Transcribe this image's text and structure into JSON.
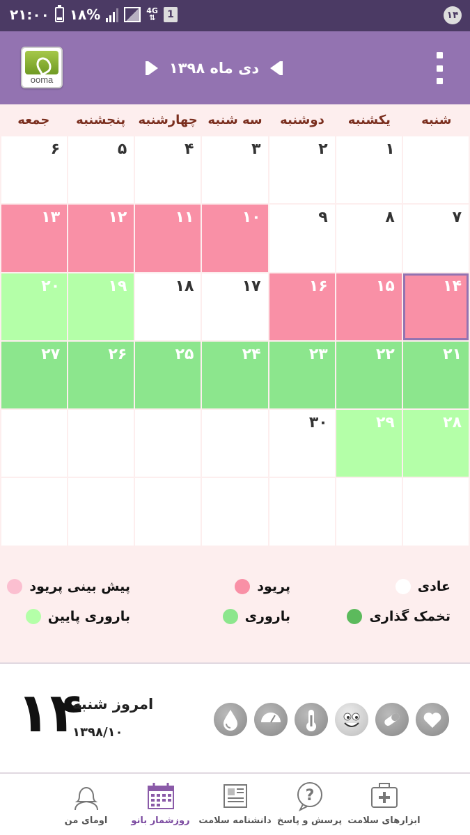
{
  "status_bar": {
    "time": "۲۱:۰۰",
    "battery": "۱۸%",
    "network": "4G",
    "sim_slot": "1",
    "notification": "۱۴"
  },
  "app_bar": {
    "logo_text": "ooma",
    "month_title": "دی ماه ۱۳۹۸"
  },
  "weekdays": [
    "شنبه",
    "یکشنبه",
    "دوشنبه",
    "سه شنبه",
    "چهارشنبه",
    "پنجشنبه",
    "جمعه"
  ],
  "calendar": {
    "rows": [
      [
        {
          "d": "",
          "t": "n"
        },
        {
          "d": "۱",
          "t": "n"
        },
        {
          "d": "۲",
          "t": "n"
        },
        {
          "d": "۳",
          "t": "n"
        },
        {
          "d": "۴",
          "t": "n"
        },
        {
          "d": "۵",
          "t": "n"
        },
        {
          "d": "۶",
          "t": "n"
        }
      ],
      [
        {
          "d": "۷",
          "t": "n"
        },
        {
          "d": "۸",
          "t": "n"
        },
        {
          "d": "۹",
          "t": "n"
        },
        {
          "d": "۱۰",
          "t": "p"
        },
        {
          "d": "۱۱",
          "t": "p"
        },
        {
          "d": "۱۲",
          "t": "p"
        },
        {
          "d": "۱۳",
          "t": "p"
        }
      ],
      [
        {
          "d": "۱۴",
          "t": "p",
          "today": true
        },
        {
          "d": "۱۵",
          "t": "p"
        },
        {
          "d": "۱۶",
          "t": "p"
        },
        {
          "d": "۱۷",
          "t": "n"
        },
        {
          "d": "۱۸",
          "t": "n"
        },
        {
          "d": "۱۹",
          "t": "l"
        },
        {
          "d": "۲۰",
          "t": "l"
        }
      ],
      [
        {
          "d": "۲۱",
          "t": "f"
        },
        {
          "d": "۲۲",
          "t": "f"
        },
        {
          "d": "۲۳",
          "t": "f"
        },
        {
          "d": "۲۴",
          "t": "f"
        },
        {
          "d": "۲۵",
          "t": "f"
        },
        {
          "d": "۲۶",
          "t": "f"
        },
        {
          "d": "۲۷",
          "t": "f"
        }
      ],
      [
        {
          "d": "۲۸",
          "t": "l"
        },
        {
          "d": "۲۹",
          "t": "l"
        },
        {
          "d": "۳۰",
          "t": "n"
        },
        {
          "d": "",
          "t": "n"
        },
        {
          "d": "",
          "t": "n"
        },
        {
          "d": "",
          "t": "n"
        },
        {
          "d": "",
          "t": "n"
        }
      ],
      [
        {
          "d": "",
          "t": "n"
        },
        {
          "d": "",
          "t": "n"
        },
        {
          "d": "",
          "t": "n"
        },
        {
          "d": "",
          "t": "n"
        },
        {
          "d": "",
          "t": "n"
        },
        {
          "d": "",
          "t": "n"
        },
        {
          "d": "",
          "t": "n"
        }
      ]
    ]
  },
  "legend": {
    "normal": {
      "label": "عادی",
      "color": "#ffffff"
    },
    "period": {
      "label": "پریود",
      "color": "#f990a6"
    },
    "period_prediction": {
      "label": "پیش بینی پریود",
      "color": "#fbbfd0"
    },
    "ovulation": {
      "label": "تخمک گذاری",
      "color": "#5cba5c"
    },
    "fertile": {
      "label": "باروری",
      "color": "#8ce68d"
    },
    "low_fertility": {
      "label": "باروری پایین",
      "color": "#b4ffa8"
    }
  },
  "today": {
    "day": "۱۴",
    "label": "امروز شنبه",
    "date": "۱۳۹۸/۱۰"
  },
  "tools": [
    "heart-icon",
    "pill-icon",
    "smiley-icon",
    "thermometer-icon",
    "weight-scale-icon",
    "drop-icon"
  ],
  "bottom_nav": [
    {
      "label": "ابزارهای سلامت",
      "icon": "first-aid-kit-icon"
    },
    {
      "label": "پرسش و پاسخ",
      "icon": "question-bubble-icon"
    },
    {
      "label": "دانشنامه سلامت",
      "icon": "newspaper-icon"
    },
    {
      "label": "روزشمار بانو",
      "icon": "calendar-icon",
      "active": true
    },
    {
      "label": "اومای من",
      "icon": "profile-icon"
    }
  ]
}
